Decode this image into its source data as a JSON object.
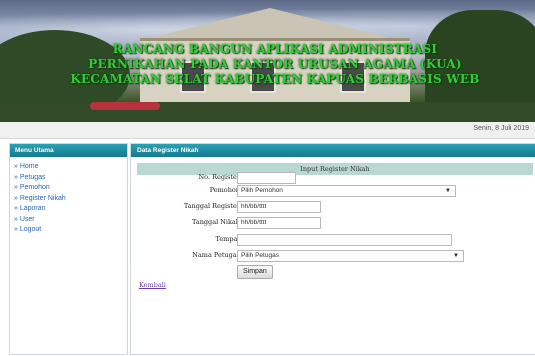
{
  "header": {
    "title": "RANCANG BANGUN APLIKASI ADMINISTRASI PERNIKAHAN PADA KANTOR URUSAN AGAMA (KUA) KECAMATAN SELAT KABUPATEN KAPUAS BERBASIS WEB"
  },
  "datebar": {
    "date": "Senin, 8 Juli 2019"
  },
  "sidebar": {
    "title": "Menu Utama",
    "items": [
      {
        "label": "» Home"
      },
      {
        "label": "» Petugas"
      },
      {
        "label": "» Pemohon"
      },
      {
        "label": "» Register Nikah"
      },
      {
        "label": "» Laporan"
      },
      {
        "label": "» User"
      },
      {
        "label": "» Logout"
      }
    ]
  },
  "main": {
    "title": "Data Register Nikah",
    "form_title": "Input Register Nikah",
    "fields": {
      "no_register": {
        "label": "No. Register",
        "value": ""
      },
      "pemohon": {
        "label": "Pemohon",
        "value": "Pilih Pemohon"
      },
      "tanggal_register": {
        "label": "Tanggal Register",
        "value": "hh/bb/tttt"
      },
      "tanggal_nikah": {
        "label": "Tanggal Nikah",
        "value": "hh/bb/tttt"
      },
      "tempat": {
        "label": "Tempat",
        "value": ""
      },
      "nama_petugas": {
        "label": "Nama Petugas",
        "value": "Pilih Petugas"
      }
    },
    "submit_label": "Simpan",
    "back_label": "Kembali"
  }
}
